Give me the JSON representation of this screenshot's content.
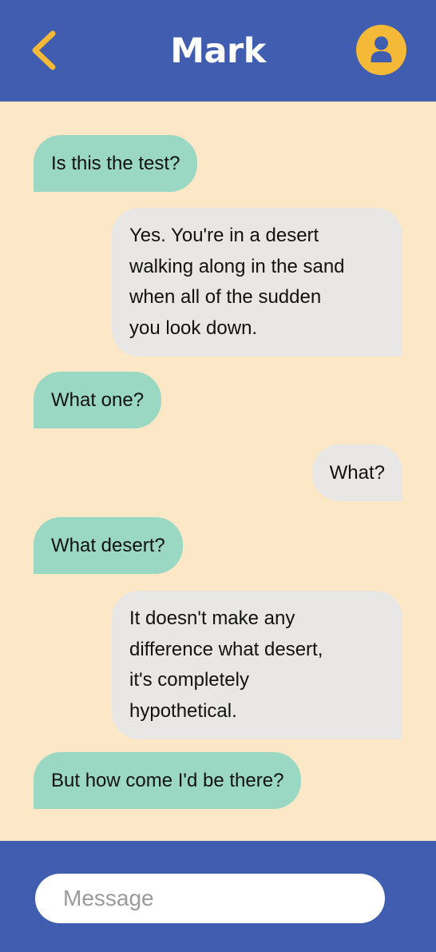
{
  "header": {
    "title": "Mark",
    "back_icon": "chevron-left-icon",
    "avatar_icon": "user-icon",
    "background": "#405daf",
    "accent": "#f5b938"
  },
  "messages": [
    {
      "from": "contact",
      "text": "Is this the test?"
    },
    {
      "from": "me",
      "text": "Yes. You're in a desert\nwalking along in the sand\nwhen all of the sudden\nyou look down."
    },
    {
      "from": "contact",
      "text": "What one?"
    },
    {
      "from": "me",
      "text": "What?"
    },
    {
      "from": "contact",
      "text": "What desert?"
    },
    {
      "from": "me",
      "text": "It doesn't make any\ndifference what desert,\nit's completely\nhypothetical."
    },
    {
      "from": "contact",
      "text": "But how come I'd be there?"
    }
  ],
  "composer": {
    "placeholder": "Message"
  },
  "colors": {
    "chat_background": "#fce8c6",
    "received_bubble": "#9ad8c4",
    "sent_bubble": "#e8e7e6"
  }
}
